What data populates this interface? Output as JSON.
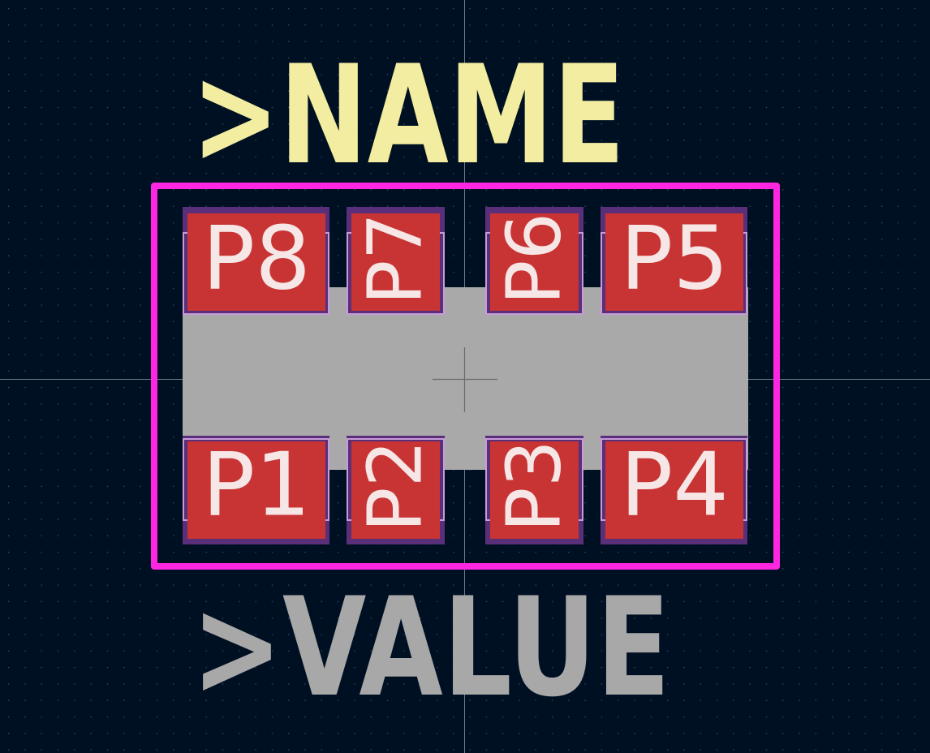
{
  "footprint": {
    "name_text": ">NAME",
    "value_text": ">VALUE",
    "pads_top": [
      "P8",
      "P7",
      "P6",
      "P5"
    ],
    "pads_bottom": [
      "P1",
      "P2",
      "P3",
      "P4"
    ]
  },
  "colors": {
    "background": "#001023",
    "grid_dot": "#3a4d66",
    "crosshair": "#c8d0dc",
    "name_text": "#f2eda1",
    "value_text": "#a8a8a8",
    "courtyard": "#ff26e2",
    "body": "#a9a9a9",
    "pad": "#c83434",
    "pad_outline_mask": "#5a2f7a",
    "pad_outline_paste": "#c89ad8",
    "pad_label": "#f6e6e6"
  }
}
